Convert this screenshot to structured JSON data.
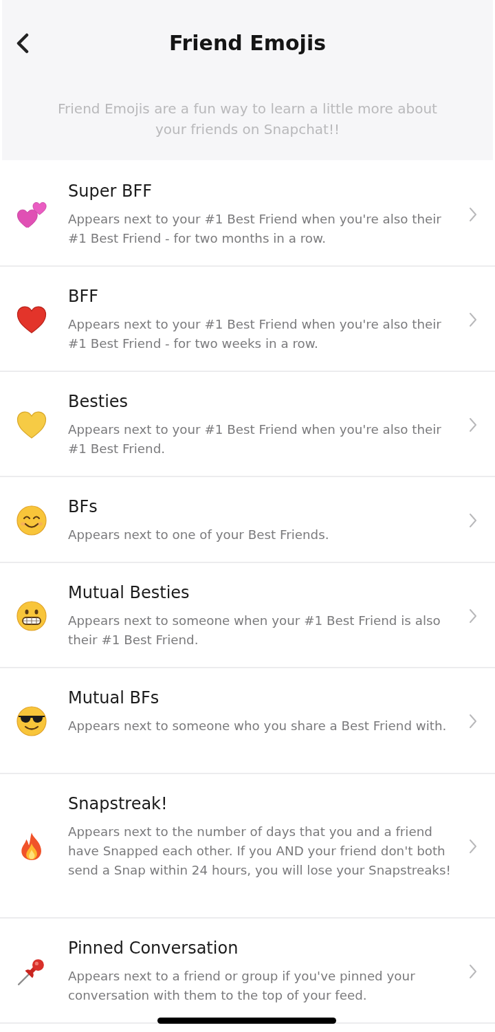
{
  "header": {
    "title": "Friend Emojis",
    "subtitle": "Friend Emojis are a fun way to learn a little more about your friends on Snapchat!!"
  },
  "items": [
    {
      "kind": "two-hearts",
      "title": "Super BFF",
      "description": "Appears next to your #1 Best Friend when you're also their #1 Best Friend - for two months in a row."
    },
    {
      "kind": "red-heart",
      "title": "BFF",
      "description": "Appears next to your #1 Best Friend when you're also their #1 Best Friend - for two weeks in a row."
    },
    {
      "kind": "yellow-heart",
      "title": "Besties",
      "description": "Appears next to your #1 Best Friend when you're also their #1 Best Friend."
    },
    {
      "kind": "smile",
      "title": "BFs",
      "description": "Appears next to one of your Best Friends."
    },
    {
      "kind": "grimace",
      "title": "Mutual Besties",
      "description": "Appears next to someone when your #1 Best Friend is also their #1 Best Friend."
    },
    {
      "kind": "sunglasses",
      "title": "Mutual BFs",
      "description": "Appears next to someone who you share a Best Friend with."
    },
    {
      "kind": "fire",
      "title": "Snapstreak!",
      "description": "Appears next to the number of days that you and a friend have Snapped each other. If you AND your friend don't both send a Snap within 24 hours, you will lose your Snapstreaks!"
    },
    {
      "kind": "pushpin",
      "title": "Pinned Conversation",
      "description": "Appears next to a friend or group if you've pinned your conversation with them to the top of your feed."
    }
  ]
}
